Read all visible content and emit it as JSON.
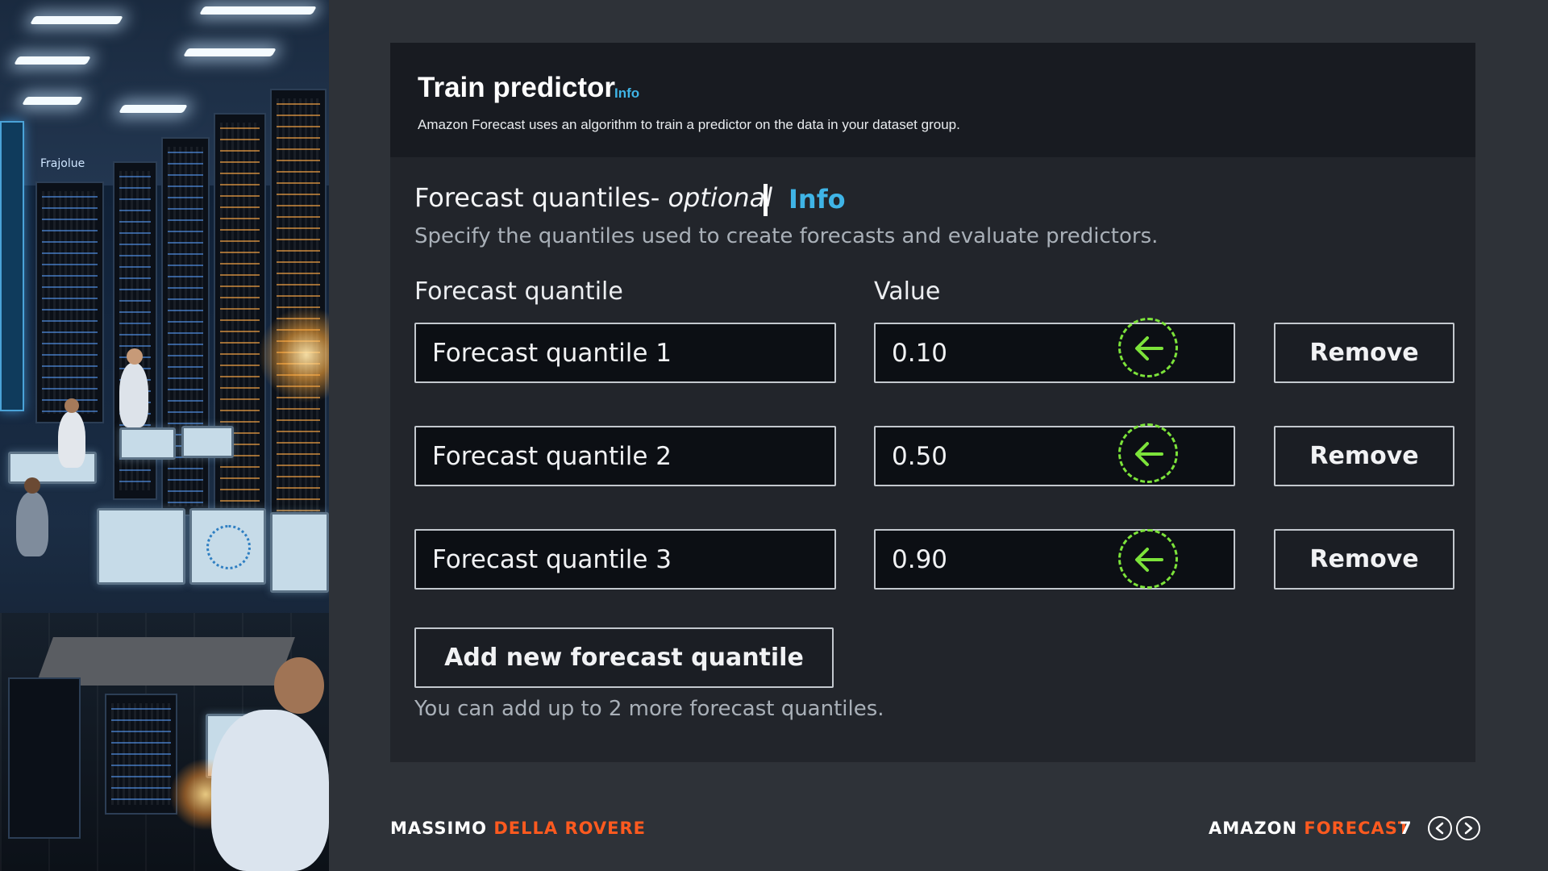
{
  "header": {
    "title": "Train predictor",
    "info_link": "Info",
    "description": "Amazon Forecast uses an algorithm to train a predictor on the data in your dataset group."
  },
  "section": {
    "title": "Forecast quantiles-",
    "optional": "optional",
    "separator": "|",
    "info_link": "Info",
    "description": "Specify the quantiles used to create forecasts and evaluate predictors."
  },
  "columns": {
    "quantile": "Forecast quantile",
    "value": "Value"
  },
  "rows": [
    {
      "name": "Forecast quantile 1",
      "value": "0.10",
      "remove_label": "Remove"
    },
    {
      "name": "Forecast quantile 2",
      "value": "0.50",
      "remove_label": "Remove"
    },
    {
      "name": "Forecast quantile 3",
      "value": "0.90",
      "remove_label": "Remove"
    }
  ],
  "add_button": "Add new forecast quantile",
  "add_note": "You can add up to 2 more forecast quantiles.",
  "footer": {
    "author_first": "MASSIMO",
    "author_last": "DELLA ROVERE",
    "product_first": "AMAZON",
    "product_last": "FORECAST",
    "page": "7"
  },
  "scene": {
    "sign_text": "Frajolue"
  },
  "colors": {
    "accent_info": "#3fb4e6",
    "accent_footer": "#ff5a1f",
    "cursor_ring": "#7ce33a",
    "panel_bg": "#22252b",
    "header_bg": "#181b21",
    "page_bg": "#2e3238"
  },
  "icons": {
    "cursor": "arrow-left-icon",
    "prev": "chevron-left-icon",
    "next": "chevron-right-icon"
  }
}
